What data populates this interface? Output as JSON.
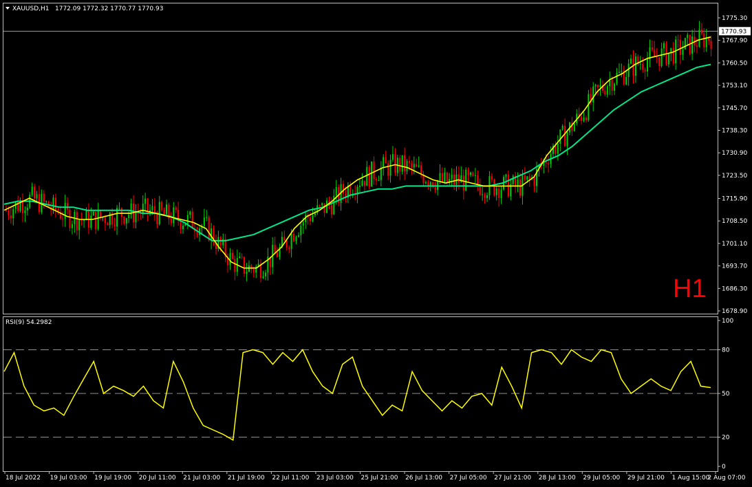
{
  "header": {
    "symbol": "XAUUSD,H1",
    "ohlc": "1772.09 1772.32 1770.77 1770.93"
  },
  "watermark": "H1",
  "price_axis": {
    "ticks": [
      "1775.30",
      "1767.90",
      "1760.50",
      "1753.10",
      "1745.70",
      "1738.30",
      "1730.90",
      "1723.50",
      "1715.90",
      "1708.50",
      "1701.10",
      "1693.70",
      "1686.30",
      "1678.90"
    ],
    "current_price": "1770.93"
  },
  "rsi_panel": {
    "label": "RSI(9) 54.2982",
    "ticks": [
      "100",
      "80",
      "50",
      "20",
      "0"
    ]
  },
  "time_axis": {
    "labels": [
      "18 Jul 2022",
      "19 Jul 03:00",
      "19 Jul 19:00",
      "20 Jul 11:00",
      "21 Jul 03:00",
      "21 Jul 19:00",
      "22 Jul 11:00",
      "23 Jul 03:00",
      "25 Jul 21:00",
      "26 Jul 13:00",
      "27 Jul 05:00",
      "27 Jul 21:00",
      "28 Jul 13:00",
      "29 Jul 05:00",
      "29 Jul 21:00",
      "1 Aug 15:00",
      "2 Aug 07:00"
    ]
  },
  "colors": {
    "background": "#000000",
    "bull_candle": "#00d000",
    "bear_candle": "#ff0000",
    "ma_fast": "#ffff00",
    "ma_slow": "#00e68a",
    "rsi_line": "#ffff00",
    "grid": "#c0c0c0",
    "watermark": "#ff0000"
  },
  "chart_data": [
    {
      "type": "line",
      "title": "XAUUSD,H1",
      "ylim": [
        1678.9,
        1775.3
      ],
      "series": [
        {
          "values": [
            1712,
            1714,
            1716,
            1714,
            1712,
            1710,
            1709,
            1709,
            1710,
            1711,
            1711,
            1712,
            1711,
            1710,
            1709,
            1708,
            1706,
            1700,
            1695,
            1693,
            1693,
            1696,
            1700,
            1706,
            1710,
            1712,
            1715,
            1719,
            1722,
            1724,
            1726,
            1727,
            1726,
            1724,
            1722,
            1721,
            1722,
            1721,
            1720,
            1720,
            1720,
            1720,
            1723,
            1730,
            1735,
            1740,
            1745,
            1751,
            1755,
            1757,
            1760,
            1762,
            1763,
            1764,
            1766,
            1768,
            1769
          ]
        },
        {
          "values": [
            1714,
            1715,
            1715,
            1714,
            1713,
            1713,
            1712,
            1712,
            1712,
            1712,
            1711,
            1711,
            1710,
            1708,
            1705,
            1702,
            1702,
            1703,
            1704,
            1706,
            1708,
            1710,
            1712,
            1713,
            1715,
            1717,
            1718,
            1719,
            1719,
            1720,
            1720,
            1720,
            1720,
            1720,
            1720,
            1720,
            1721,
            1723,
            1725,
            1728,
            1730,
            1733,
            1737,
            1741,
            1745,
            1748,
            1751,
            1753,
            1755,
            1757,
            1759,
            1760
          ]
        }
      ]
    },
    {
      "type": "line",
      "title": "RSI(9) 54.2982",
      "ylim": [
        0,
        100
      ],
      "series": [
        {
          "values": [
            65,
            78,
            55,
            42,
            38,
            40,
            35,
            48,
            60,
            72,
            50,
            55,
            52,
            48,
            55,
            45,
            40,
            72,
            58,
            40,
            28,
            25,
            22,
            18,
            78,
            80,
            78,
            70,
            78,
            72,
            80,
            65,
            55,
            50,
            70,
            75,
            55,
            45,
            35,
            42,
            38,
            65,
            52,
            45,
            38,
            45,
            40,
            48,
            50,
            42,
            68,
            55,
            40,
            78,
            80,
            78,
            70,
            80,
            75,
            72,
            80,
            78,
            60,
            50,
            55,
            60,
            55,
            52,
            65,
            72,
            55,
            54
          ]
        }
      ]
    }
  ]
}
